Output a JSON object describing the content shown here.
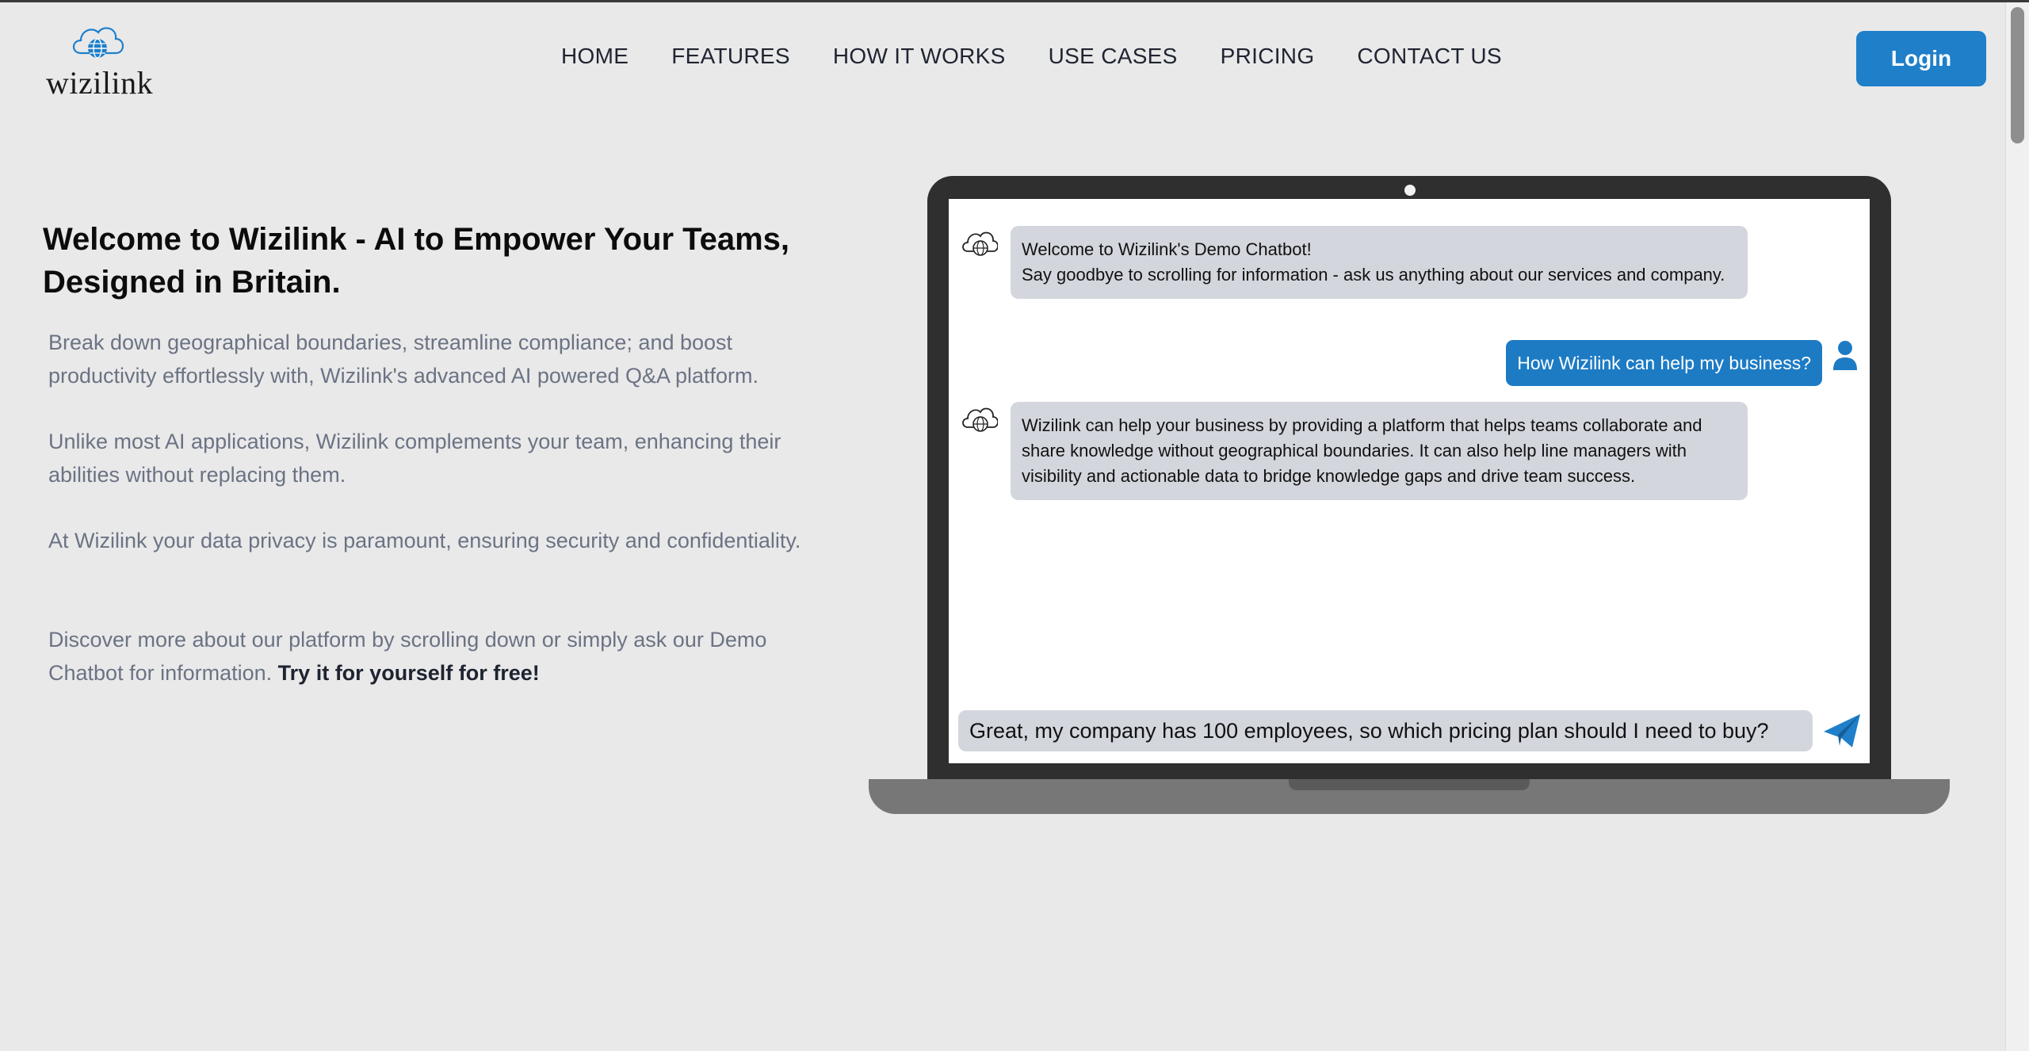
{
  "brand": {
    "name": "wizilink"
  },
  "nav": {
    "items": [
      {
        "label": "HOME"
      },
      {
        "label": "FEATURES"
      },
      {
        "label": "HOW IT WORKS"
      },
      {
        "label": "USE CASES"
      },
      {
        "label": "PRICING"
      },
      {
        "label": "CONTACT US"
      }
    ],
    "login_label": "Login"
  },
  "hero": {
    "title": "Welcome to Wizilink - AI to Empower Your Teams, Designed in Britain.",
    "paragraphs": [
      "Break down geographical boundaries, streamline compliance; and boost productivity effortlessly with, Wizilink's advanced AI powered Q&A platform.",
      "Unlike most AI applications, Wizilink complements your team, enhancing their abilities without replacing them.",
      "At Wizilink your data privacy is paramount, ensuring security and confidentiality."
    ],
    "cta_text": "Discover more about our platform by scrolling down or simply ask our Demo Chatbot for information.",
    "cta_bold": "Try it for yourself for free!"
  },
  "chat": {
    "messages": [
      {
        "role": "bot",
        "lines": [
          "Welcome to Wizilink's Demo Chatbot!",
          "Say goodbye to scrolling for information - ask us anything about our services and company."
        ]
      },
      {
        "role": "user",
        "text": "How Wizilink can help my business?"
      },
      {
        "role": "bot",
        "text": "Wizilink can help your business by providing a platform that helps teams collaborate and share knowledge without geographical boundaries. It can also help line managers with visibility and actionable data to bridge knowledge gaps and drive team success."
      }
    ],
    "input_value": "Great, my company has 100 employees, so which pricing plan should I need to buy?"
  },
  "colors": {
    "accent": "#1f7fc9",
    "background": "#e9e9ea",
    "bot_bubble": "#d3d6dd",
    "muted_text": "#6b7383"
  },
  "icons": {
    "logo": "cloud-globe-icon",
    "bot_avatar": "cloud-globe-icon",
    "user_avatar": "user-icon",
    "send": "send-plane-icon"
  }
}
